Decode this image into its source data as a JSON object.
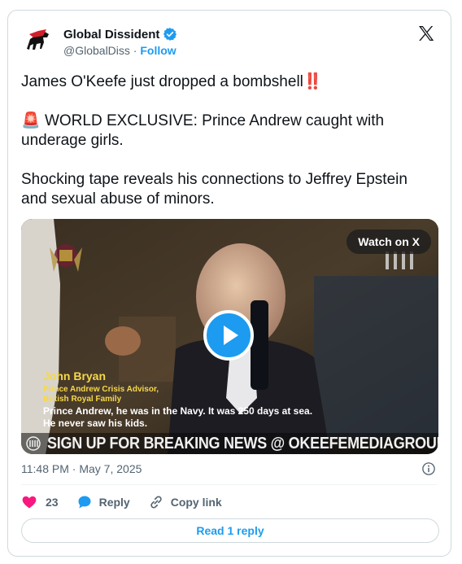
{
  "author": {
    "display_name": "Global Dissident",
    "handle": "@GlobalDiss",
    "separator": "·",
    "follow_label": "Follow",
    "avatar_text": "Global Dissident"
  },
  "tweet": {
    "line1": "James O'Keefe just dropped a bombshell",
    "line1_emoji": "‼️",
    "line2_emoji": "🚨",
    "line2": "WORLD EXCLUSIVE: Prince Andrew caught with underage girls.",
    "line3": "Shocking tape reveals his connections to Jeffrey Epstein and sexual abuse of minors."
  },
  "media": {
    "watch_label": "Watch on X",
    "caption_name": "John Bryan",
    "caption_role1": "Prince Andrew Crisis Advisor,",
    "caption_role2": "British Royal Family",
    "caption_quote1": "Prince Andrew, he was in the Navy. It was 250 days at sea.",
    "caption_quote2": "He never saw his kids.",
    "banner_text": "SIGN UP FOR BREAKING NEWS @ OKEEFEMEDIAGROUP.COM"
  },
  "meta": {
    "time": "11:48 PM",
    "separator": "·",
    "date": "May 7, 2025"
  },
  "actions": {
    "like_count": "23",
    "reply_label": "Reply",
    "copy_label": "Copy link"
  },
  "read_replies_label": "Read 1 reply",
  "colors": {
    "accent": "#1d9bf0",
    "like": "#f91880",
    "text": "#0f1419",
    "muted": "#536471"
  }
}
